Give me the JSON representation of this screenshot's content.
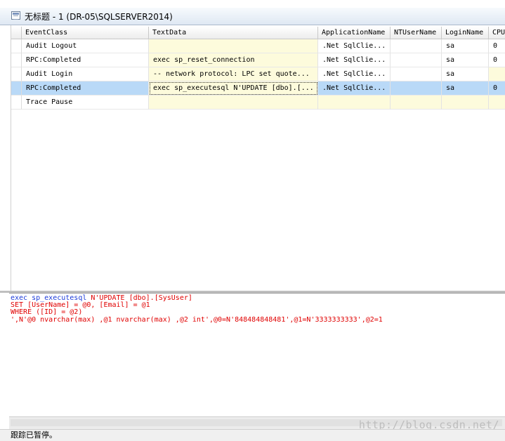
{
  "window": {
    "title": "无标题 - 1 (DR-05\\SQLSERVER2014)"
  },
  "grid": {
    "columns": [
      "EventClass",
      "TextData",
      "ApplicationName",
      "NTUserName",
      "LoginName",
      "CPU"
    ],
    "rows": [
      {
        "event": "Audit Logout",
        "text": "",
        "app": ".Net SqlClie...",
        "nt": "",
        "login": "sa",
        "cpu": "0"
      },
      {
        "event": "RPC:Completed",
        "text": "exec sp_reset_connection",
        "app": ".Net SqlClie...",
        "nt": "",
        "login": "sa",
        "cpu": "0"
      },
      {
        "event": "Audit Login",
        "text": "-- network protocol: LPC  set quote...",
        "app": ".Net SqlClie...",
        "nt": "",
        "login": "sa",
        "cpu": ""
      },
      {
        "event": "RPC:Completed",
        "text": "exec sp_executesql N'UPDATE [dbo].[...",
        "app": ".Net SqlClie...",
        "nt": "",
        "login": "sa",
        "cpu": "0"
      },
      {
        "event": "Trace Pause",
        "text": "",
        "app": "",
        "nt": "",
        "login": "",
        "cpu": ""
      }
    ],
    "selected_row": 4
  },
  "detail": {
    "line1_a": "exec sp_executesql ",
    "line1_b": "N'UPDATE [dbo].[SysUser]",
    "line2": "SET [UserName] = @0, [Email] = @1",
    "line3": "WHERE ([ID] = @2)",
    "line4": "',N'@0 nvarchar(max) ,@1 nvarchar(max) ,@2 int',@0=N'848484848481',@1=N'3333333333',@2=1"
  },
  "status": {
    "text": "跟踪已暂停。"
  },
  "watermark": "http://blog.csdn.net/",
  "colors": {
    "selected_row": "#b9d9f7",
    "highlight_cell": "#fdfbdc",
    "sql_red": "#e00000",
    "sql_blue": "#1c3bd9"
  }
}
